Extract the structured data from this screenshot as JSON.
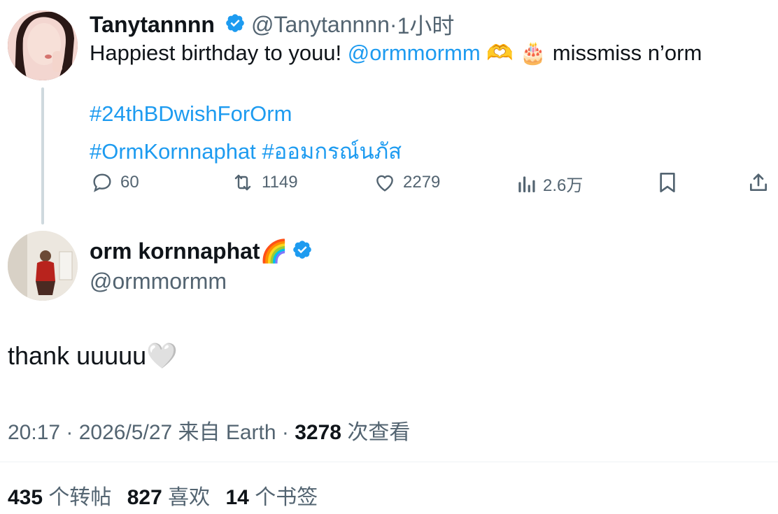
{
  "parent_tweet": {
    "display_name": "Tanytannnn",
    "handle": "@Tanytannnn",
    "separator": "·",
    "time": "1小时",
    "text_prefix": "Happiest birthday to youu! ",
    "mention": "@ormmormm",
    "emoji_1": "🫶",
    "emoji_2": "🎂",
    "text_suffix": " missmiss n’orm",
    "hashtag_line_1": "#24thBDwishForOrm",
    "hashtag_line_2a": "#OrmKornnaphat",
    "hashtag_line_2b": "#ออมกรณ์นภัส",
    "actions": {
      "replies": "60",
      "retweets": "1149",
      "likes": "2279",
      "views": "2.6万"
    }
  },
  "reply_tweet": {
    "display_name": "orm kornnaphat",
    "name_emoji": "🌈",
    "handle": "@ormmormm",
    "text": "thank uuuuu",
    "text_emoji": "🤍",
    "timestamp": "20:17 · 2026/5/27 来自 Earth · ",
    "view_count": "3278",
    "view_label": " 次查看"
  },
  "stats": {
    "retweets_count": "435",
    "retweets_label": " 个转帖",
    "likes_count": "827",
    "likes_label": " 喜欢",
    "bookmarks_count": "14",
    "bookmarks_label": " 个书签"
  },
  "colors": {
    "accent": "#1d9bf0",
    "text_primary": "#0f1419",
    "text_secondary": "#536471"
  },
  "icons": {
    "verified": "verified-badge-icon",
    "reply": "reply-bubble-icon",
    "retweet": "retweet-icon",
    "like": "heart-icon",
    "views": "views-bar-chart-icon",
    "bookmark": "bookmark-icon",
    "share": "share-upload-icon"
  }
}
